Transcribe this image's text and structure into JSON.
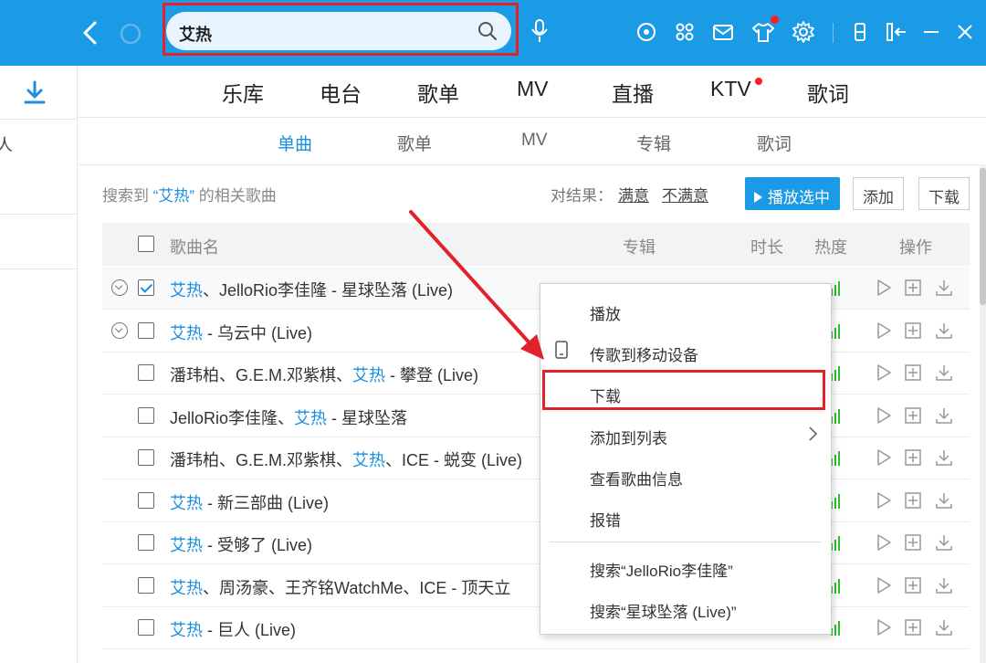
{
  "search": {
    "query": "艾热"
  },
  "sidebar": {
    "partial_text": "人"
  },
  "main_tabs": [
    {
      "label": "乐库"
    },
    {
      "label": "电台"
    },
    {
      "label": "歌单"
    },
    {
      "label": "MV"
    },
    {
      "label": "直播"
    },
    {
      "label": "KTV"
    },
    {
      "label": "歌词"
    }
  ],
  "sub_tabs": [
    {
      "label": "单曲",
      "active": true
    },
    {
      "label": "歌单"
    },
    {
      "label": "MV"
    },
    {
      "label": "专辑"
    },
    {
      "label": "歌词"
    }
  ],
  "result": {
    "prefix": "搜索到",
    "keyword": "“艾热”",
    "suffix": "的相关歌曲"
  },
  "feedback": {
    "label": "对结果：",
    "good": "满意",
    "bad": "不满意"
  },
  "buttons": {
    "play_selected": "播放选中",
    "add": "添加",
    "download": "下载"
  },
  "table": {
    "headers": {
      "name": "歌曲名",
      "album": "专辑",
      "duration": "时长",
      "heat": "热度",
      "ops": "操作"
    },
    "rows": [
      {
        "kw": "艾热",
        "rest": "、JelloRio李佳隆 - 星球坠落 (Live)",
        "checked": true,
        "expandable": true
      },
      {
        "kw": "艾热",
        "rest": " - 乌云中 (Live)",
        "checked": false,
        "expandable": true
      },
      {
        "pre": "潘玮柏、G.E.M.邓紫棋、",
        "kw": "艾热",
        "rest": " - 攀登 (Live)",
        "checked": false,
        "expandable": false
      },
      {
        "pre": "JelloRio李佳隆、",
        "kw": "艾热",
        "rest": " - 星球坠落",
        "checked": false,
        "expandable": false
      },
      {
        "pre": "潘玮柏、G.E.M.邓紫棋、",
        "kw": "艾热",
        "rest": "、ICE - 蜕变 (Live)",
        "checked": false,
        "expandable": false
      },
      {
        "kw": "艾热",
        "rest": " - 新三部曲 (Live)",
        "checked": false,
        "expandable": false
      },
      {
        "kw": "艾热",
        "rest": " - 受够了 (Live)",
        "checked": false,
        "expandable": false
      },
      {
        "kw": "艾热",
        "rest": "、周汤豪、王齐铭WatchMe、ICE - 顶天立",
        "checked": false,
        "expandable": false
      },
      {
        "kw": "艾热",
        "rest": " - 巨人 (Live)",
        "checked": false,
        "expandable": false
      }
    ]
  },
  "context_menu": {
    "items": [
      {
        "label": "播放"
      },
      {
        "label": "传歌到移动设备"
      },
      {
        "label": "下载",
        "highlighted": true
      },
      {
        "label": "添加到列表"
      },
      {
        "label": "查看歌曲信息"
      },
      {
        "label": "报错"
      },
      {
        "label": "搜索“JelloRio李佳隆”"
      },
      {
        "label": "搜索“星球坠落 (Live)”"
      }
    ]
  },
  "colors": {
    "topbar": "#1b9ae6",
    "accent": "#1a8fe0",
    "annotation_red": "#e1222a",
    "heat_green": "#2fbf2f"
  },
  "icons": [
    "back-icon",
    "refresh-icon",
    "search-icon",
    "mic-icon",
    "radio-icon",
    "apps-icon",
    "mail-icon",
    "skin-icon",
    "settings-icon",
    "mini-mode-icon",
    "collapse-icon",
    "minimize-icon",
    "close-icon",
    "download-icon",
    "play-icon",
    "add-icon",
    "phone-icon",
    "chevron-right-icon"
  ]
}
